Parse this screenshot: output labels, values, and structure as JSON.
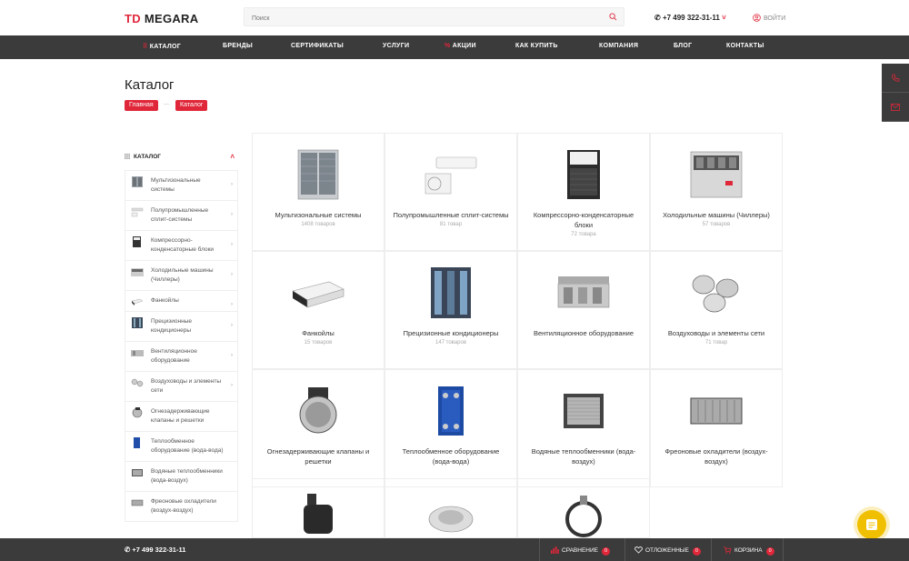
{
  "header": {
    "logo_td": "TD",
    "logo_name": "MEGARA",
    "search_placeholder": "Поиск",
    "phone": "+7 499 322-31-11",
    "phone_arrow": "˅",
    "login": "ВОЙТИ"
  },
  "nav": {
    "items": [
      "КАТАЛОГ",
      "БРЕНДЫ",
      "СЕРТИФИКАТЫ",
      "УСЛУГИ",
      "АКЦИИ",
      "КАК КУПИТЬ",
      "КОМПАНИЯ",
      "БЛОГ",
      "КОНТАКТЫ"
    ]
  },
  "page": {
    "title": "Каталог",
    "breadcrumbs": [
      "Главная",
      "Каталог"
    ],
    "breadcrumb_sep": "—"
  },
  "sidebar": {
    "title": "КАТАЛОГ",
    "items": [
      "Мультизональные системы",
      "Полупромышленные сплит-системы",
      "Компрессорно-конденсаторные блоки",
      "Холодильные машины (Чиллеры)",
      "Фанкойлы",
      "Прецизионные кондиционеры",
      "Вентиляционное оборудование",
      "Воздуховоды и элементы сети",
      "Огнезадерживающие клапаны и решетки",
      "Теплообменное оборудование (вода-вода)",
      "Водяные теплообменники (вода-воздух)",
      "Фреоновые охладители (воздух-воздух)"
    ]
  },
  "catalog": {
    "categories": [
      {
        "name": "Мультизональные системы",
        "count": "1408 товаров",
        "icon": "vrf-unit-icon"
      },
      {
        "name": "Полупромышленные сплит-системы",
        "count": "81 товар",
        "icon": "split-system-icon"
      },
      {
        "name": "Компрессорно-конденсаторные блоки",
        "count": "72 товара",
        "icon": "condensing-unit-icon"
      },
      {
        "name": "Холодильные машины (Чиллеры)",
        "count": "57 товаров",
        "icon": "chiller-icon"
      },
      {
        "name": "Фанкойлы",
        "count": "15 товаров",
        "icon": "fancoil-icon"
      },
      {
        "name": "Прецизионные кондиционеры",
        "count": "147 товаров",
        "icon": "precision-ac-icon"
      },
      {
        "name": "Вентиляционное оборудование",
        "count": "",
        "icon": "ventilation-unit-icon"
      },
      {
        "name": "Воздуховоды и элементы сети",
        "count": "71 товар",
        "icon": "air-duct-icon"
      },
      {
        "name": "Огнезадерживающие клапаны и решетки",
        "count": "",
        "icon": "fire-damper-icon"
      },
      {
        "name": "Теплообменное оборудование (вода-вода)",
        "count": "",
        "icon": "plate-heat-exchanger-icon"
      },
      {
        "name": "Водяные теплообменники (вода-воздух)",
        "count": "",
        "icon": "water-coil-icon"
      },
      {
        "name": "Фреоновые охладители (воздух-воздух)",
        "count": "",
        "icon": "freon-cooler-icon"
      },
      {
        "name": "",
        "count": "",
        "icon": "pump-icon"
      },
      {
        "name": "",
        "count": "",
        "icon": "insulation-icon"
      },
      {
        "name": "",
        "count": "",
        "icon": "pipe-clamp-icon"
      }
    ]
  },
  "footer": {
    "phone": "+7 499 322-31-11",
    "compare_label": "СРАВНЕНИЕ",
    "compare_count": "0",
    "deferred_label": "ОТЛОЖЕННЫЕ",
    "deferred_count": "0",
    "cart_label": "КОРЗИНА",
    "cart_count": "0"
  },
  "colors": {
    "accent": "#e0273a",
    "nav_bg": "#3b3b3b",
    "chat": "#f0c000"
  }
}
